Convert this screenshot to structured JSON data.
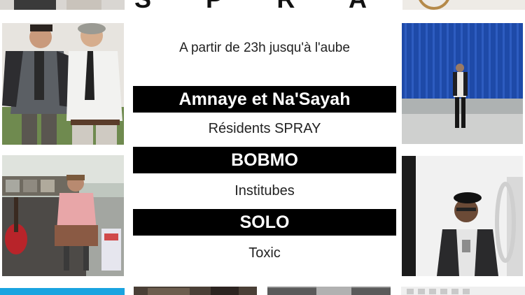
{
  "header": {
    "title_fragment": "S P R A Y"
  },
  "event": {
    "time_text": "A partir de 23h jusqu'à l'aube",
    "lineup": [
      {
        "artist": "Amnaye et Na'Sayah",
        "label": "Résidents SPRAY"
      },
      {
        "artist": "BOBMO",
        "label": "Institubes"
      },
      {
        "artist": "SOLO",
        "label": "Toxic"
      }
    ]
  },
  "colors": {
    "band_background": "#000000",
    "band_text": "#ffffff",
    "page_background": "#ffffff",
    "blue_wall": "#1e4aa8"
  }
}
